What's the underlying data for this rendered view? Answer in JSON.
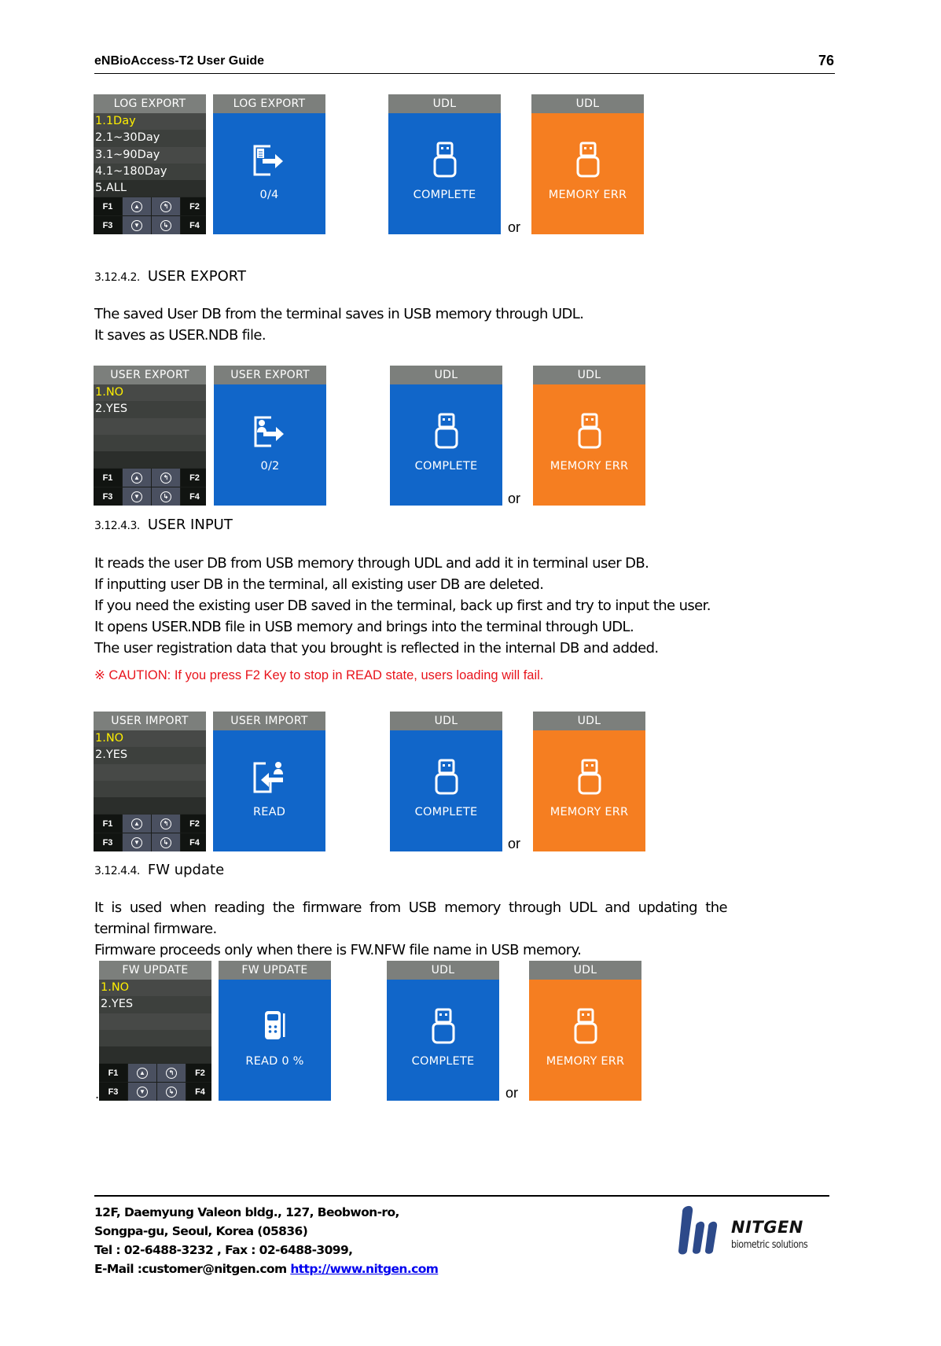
{
  "header": {
    "title": "eNBioAccess-T2 User Guide",
    "page_number": "76"
  },
  "sections": {
    "log_export": {
      "menu": {
        "title": "LOG  EXPORT",
        "items": [
          "1.1Day",
          "2.1~30Day",
          "3.1~90Day",
          "4.1~180Day",
          "5.ALL"
        ]
      },
      "progress": {
        "title": "LOG  EXPORT",
        "label": "0/4"
      }
    },
    "user_export": {
      "heading_number": "3.12.4.2.",
      "heading": "USER EXPORT",
      "paragraphs": [
        "The saved User DB from the terminal saves in USB memory through UDL.",
        "It saves as USER.NDB file."
      ],
      "menu": {
        "title": "USER EXPORT",
        "items": [
          "1.NO",
          "2.YES"
        ]
      },
      "progress": {
        "title": "USER EXPORT",
        "label": "0/2"
      }
    },
    "user_input": {
      "heading_number": "3.12.4.3.",
      "heading": "USER INPUT",
      "paragraphs": [
        "It reads the user DB from USB memory through UDL and add it in terminal user DB.",
        "If inputting user DB in the terminal, all existing user DB are deleted.",
        "If you need the existing user DB saved in the terminal, back up first and try to input the user.",
        "It opens USER.NDB file in USB memory and brings into the terminal through UDL.",
        "The user registration data that you brought is reflected in the internal DB and added."
      ],
      "caution": "※  CAUTION: If you press F2 Key to stop in READ state, users loading will fail.",
      "menu": {
        "title": "USER IMPORT",
        "items": [
          "1.NO",
          "2.YES"
        ]
      },
      "progress": {
        "title": "USER IMPORT",
        "label": "READ"
      }
    },
    "fw_update": {
      "heading_number": "3.12.4.4.",
      "heading": "FW update",
      "paragraphs": [
        "It  is  used  when  reading  the  firmware  from  USB  memory  through  UDL  and  updating  the",
        "terminal firmware.",
        "Firmware proceeds only when there is FW.NFW file name in USB memory."
      ],
      "menu": {
        "title": "FW UPDATE",
        "items": [
          "1.NO",
          "2.YES"
        ]
      },
      "progress": {
        "title": "FW UPDATE",
        "label": "READ 0 %"
      },
      "stray_mark": "."
    }
  },
  "udl": {
    "title": "UDL",
    "complete": "COMPLETE",
    "error": "MEMORY ERR",
    "or": "or"
  },
  "keys": {
    "f1": "F1",
    "f2": "F2",
    "f3": "F3",
    "f4": "F4"
  },
  "colors": {
    "screen_blue": "#1166c9",
    "screen_orange": "#f57e21",
    "title_bar": "#7c7f7c",
    "selected_item": "#ffef00",
    "caution_red": "#e8141c"
  },
  "footer": {
    "lines": [
      "12F, Daemyung Valeon bldg., 127, Beobwon-ro,",
      "Songpa-gu, Seoul, Korea (05836)",
      "Tel : 02-6488-3232 , Fax : 02-6488-3099,"
    ],
    "email": "E-Mail :customer@nitgen.com",
    "url": "http://www.nitgen.com",
    "logo_name": "NITGEN",
    "logo_tagline": "biometric solutions"
  }
}
